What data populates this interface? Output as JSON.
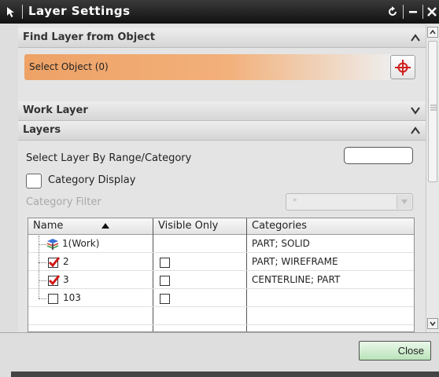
{
  "window": {
    "title": "Layer Settings",
    "title_icon": "arrow-cursor-icon",
    "buttons": [
      "reset-icon",
      "minimize-icon",
      "close-x-icon"
    ]
  },
  "sections": {
    "find_layer": {
      "label": "Find Layer from Object",
      "expanded": true
    },
    "select_object": {
      "label": "Select Object (0)",
      "icon": "crosshair-icon",
      "accent": "#f0a060"
    },
    "work_layer": {
      "label": "Work Layer",
      "expanded": false
    },
    "layers": {
      "label": "Layers",
      "expanded": true
    }
  },
  "layers_panel": {
    "range_label": "Select Layer By Range/Category",
    "range_value": "",
    "category_display_label": "Category Display",
    "category_display_checked": false,
    "category_filter_label": "Category Filter",
    "category_filter_value": "*"
  },
  "table": {
    "columns": [
      "Name",
      "Visible Only",
      "Categories"
    ],
    "sort_column": "Name",
    "sort_direction": "ascending",
    "rows": [
      {
        "name": "1(Work)",
        "icon": "layers-stack-icon",
        "visible_only": null,
        "categories": "PART; SOLID"
      },
      {
        "name": "2",
        "checked": true,
        "visible_only": false,
        "categories": "PART; WIREFRAME"
      },
      {
        "name": "3",
        "checked": true,
        "visible_only": false,
        "categories": "CENTERLINE; PART"
      },
      {
        "name": "103",
        "checked": false,
        "visible_only": false,
        "categories": ""
      }
    ]
  },
  "footer": {
    "close_label": "Close"
  },
  "colors": {
    "titlebar": "#1a1a1a",
    "check_red": "#d01818",
    "close_button": "#c6eac6"
  }
}
